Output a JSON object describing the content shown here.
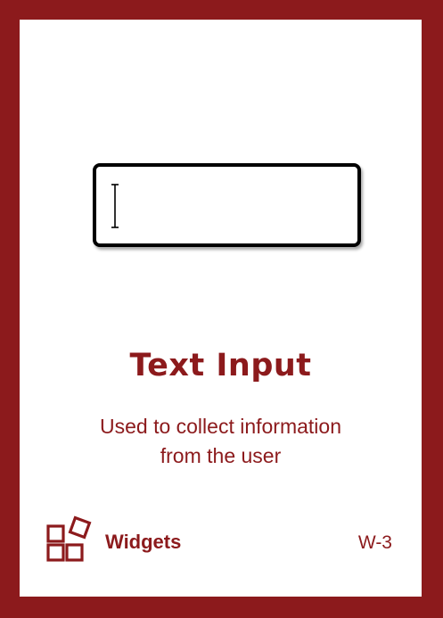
{
  "card": {
    "title": "Text Input",
    "description_lines": [
      "Used to collect information",
      "from the user"
    ],
    "category": {
      "icon": "widgets-icon",
      "label": "Widgets"
    },
    "code": "W-3"
  },
  "illustration": {
    "type": "empty-text-input",
    "cursor_icon": "text-cursor-icon"
  },
  "colors": {
    "brand": "#8c1a1c",
    "background": "#ffffff",
    "input_border": "#000000"
  }
}
